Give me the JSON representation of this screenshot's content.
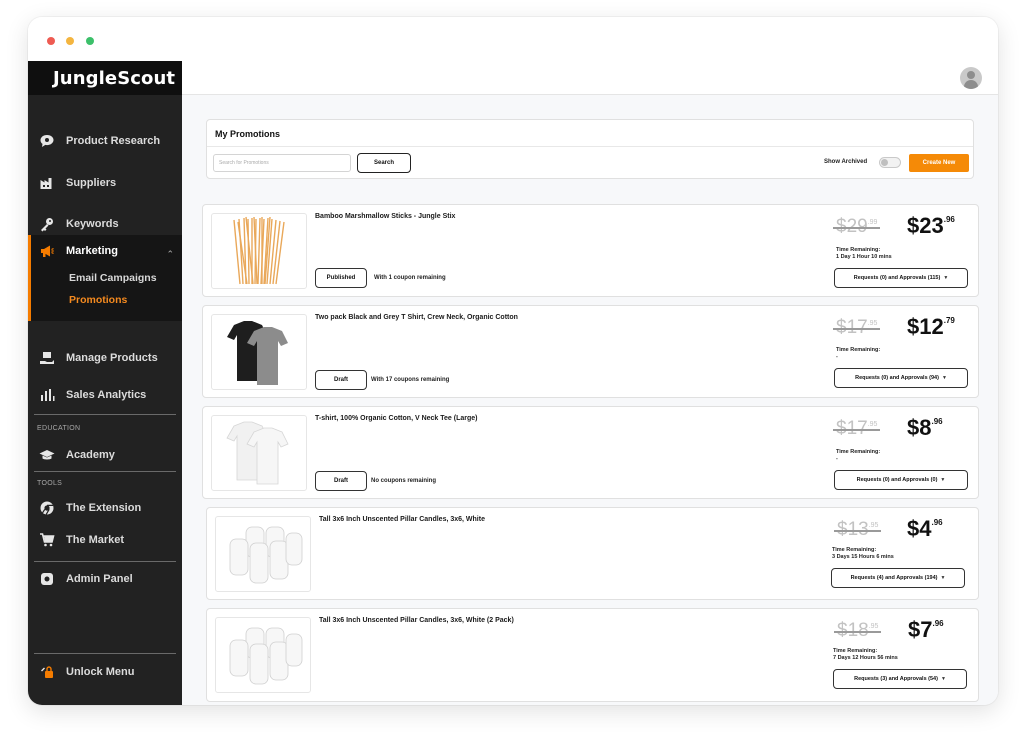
{
  "app": {
    "logo": "JungleScout"
  },
  "sidebar": {
    "items": [
      {
        "label": "Product Research",
        "icon": "chat-bubble-icon"
      },
      {
        "label": "Suppliers",
        "icon": "factory-icon"
      },
      {
        "label": "Keywords",
        "icon": "key-icon"
      },
      {
        "label": "Marketing",
        "icon": "megaphone-icon"
      },
      {
        "label": "Manage Products",
        "icon": "box-hand-icon"
      },
      {
        "label": "Sales Analytics",
        "icon": "bar-chart-icon"
      },
      {
        "label": "Academy",
        "icon": "graduation-cap-icon"
      },
      {
        "label": "The Extension",
        "icon": "chrome-icon"
      },
      {
        "label": "The Market",
        "icon": "cart-icon"
      },
      {
        "label": "Admin Panel",
        "icon": "admin-icon"
      }
    ],
    "marketing_sub": [
      "Email Campaigns",
      "Promotions"
    ],
    "sections": {
      "education": "EDUCATION",
      "tools": "TOOLS"
    },
    "unlock": {
      "label": "Unlock Menu",
      "icon": "unlock-icon"
    },
    "accent_color": "#f57c00"
  },
  "promotions": {
    "title": "My Promotions",
    "search_placeholder": "Search for Promotions",
    "search_button": "Search",
    "show_archived": "Show Archived",
    "create_button": "Create New",
    "items": [
      {
        "title": "Bamboo Marshmallow Sticks - Jungle Stix",
        "status": "Published",
        "coupons": "With 1 coupon remaining",
        "old_price_main": "$29",
        "old_price_cents": ".99",
        "new_price_main": "$23",
        "new_price_cents": ".96",
        "time_label": "Time Remaining:",
        "time_value": "1 Day 1 Hour 10 mins",
        "requests": "Requests (0) and Approvals (115)"
      },
      {
        "title": "Two pack Black and Grey T Shirt, Crew Neck, Organic Cotton",
        "status": "Draft",
        "coupons": "With 17 coupons remaining",
        "old_price_main": "$17",
        "old_price_cents": ".95",
        "new_price_main": "$12",
        "new_price_cents": ".79",
        "time_label": "Time Remaining:",
        "time_value": "-",
        "requests": "Requests (0) and Approvals (94)"
      },
      {
        "title": "T-shirt, 100% Organic Cotton, V Neck Tee  (Large)",
        "status": "Draft",
        "coupons": "No coupons remaining",
        "old_price_main": "$17",
        "old_price_cents": ".95",
        "new_price_main": "$8",
        "new_price_cents": ".96",
        "time_label": "Time Remaining:",
        "time_value": "-",
        "requests": "Requests (0) and Approvals (0)"
      },
      {
        "title": "Tall 3x6 Inch Unscented Pillar Candles, 3x6, White",
        "status": "",
        "coupons": "",
        "old_price_main": "$13",
        "old_price_cents": ".95",
        "new_price_main": "$4",
        "new_price_cents": ".96",
        "time_label": "Time Remaining:",
        "time_value": "3 Days 15 Hours 6 mins",
        "requests": "Requests (4) and Approvals (194)"
      },
      {
        "title": "Tall 3x6 Inch Unscented Pillar Candles, 3x6, White  (2 Pack)",
        "status": "",
        "coupons": "",
        "old_price_main": "$18",
        "old_price_cents": ".95",
        "new_price_main": "$7",
        "new_price_cents": ".96",
        "time_label": "Time Remaining:",
        "time_value": "7 Days 12 Hours 56 mins",
        "requests": "Requests (3) and Approvals (54)"
      }
    ]
  },
  "colors": {
    "sidebar_bg": "#222222",
    "accent": "#f58a07",
    "active_sub": "#f58a1f"
  }
}
